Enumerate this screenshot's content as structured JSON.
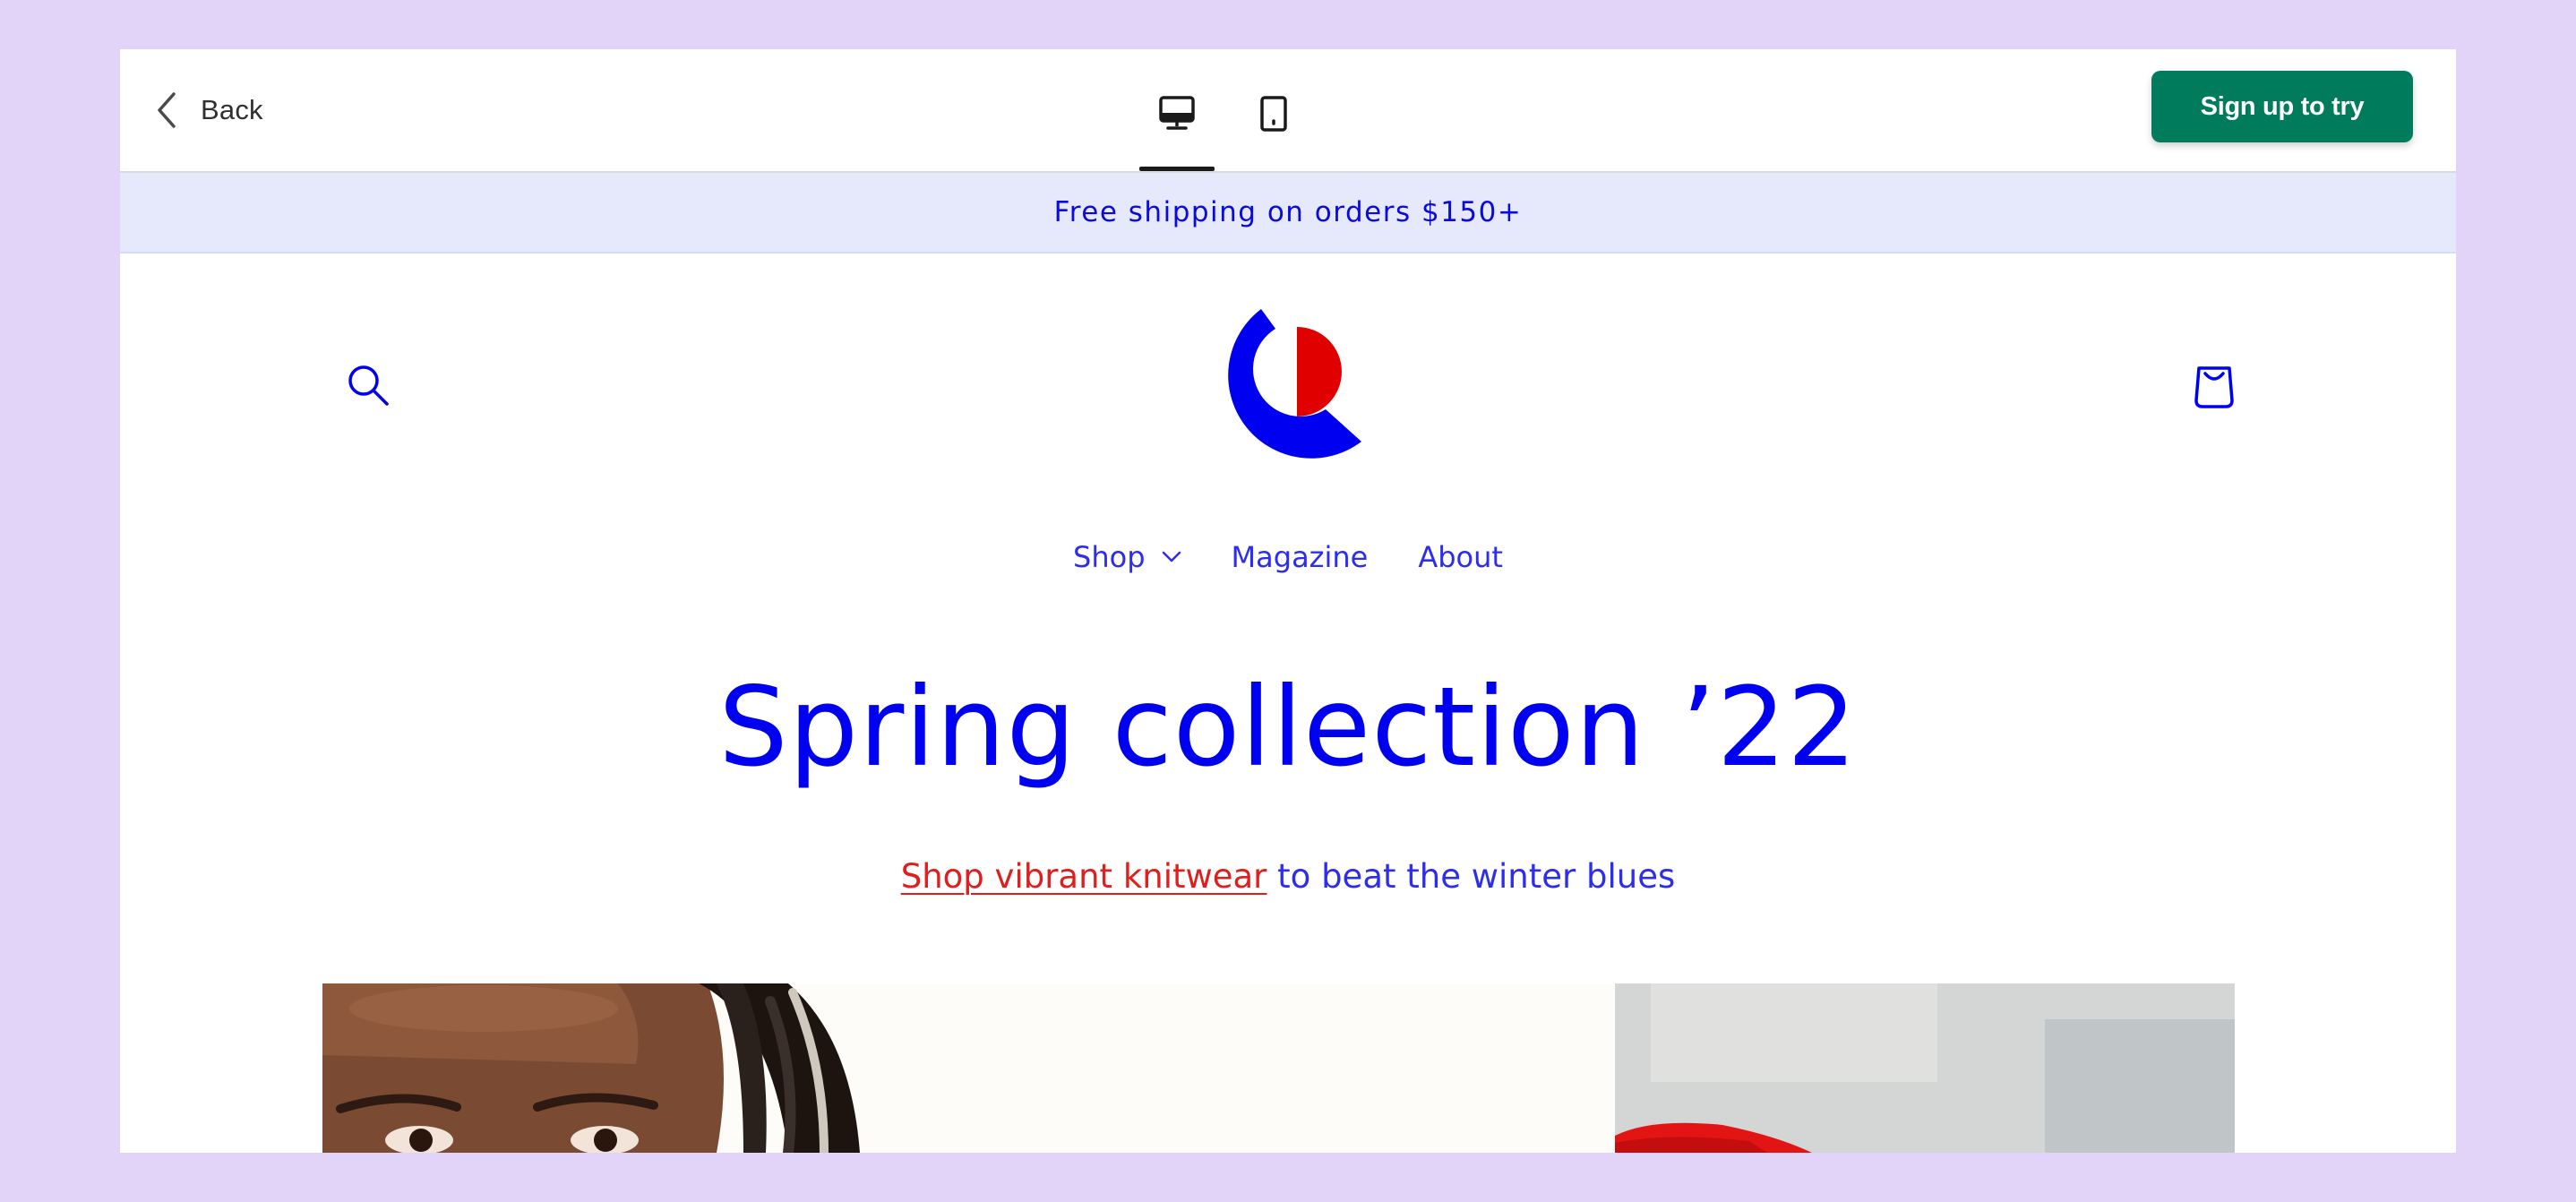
{
  "toolbar": {
    "back_label": "Back",
    "device_tabs": [
      "desktop-view",
      "mobile-view"
    ],
    "active_tab": "desktop-view",
    "signup_label": "Sign up to try",
    "signup_color": "#007b5c"
  },
  "announcement": {
    "text": "Free shipping on orders $150+"
  },
  "store": {
    "nav": {
      "shop": "Shop",
      "magazine": "Magazine",
      "about": "About"
    },
    "hero": {
      "title": "Spring collection ’22",
      "link_text": "Shop vibrant knitwear",
      "rest_text": " to beat the winter blues"
    },
    "colors": {
      "primary": "#0000f0",
      "accent": "#e01e1e",
      "announcement_bg": "#e6e9fc",
      "page_bg": "#e2d3f8"
    },
    "icons": [
      "search-icon",
      "logo",
      "cart-icon",
      "chevron-down-icon"
    ]
  }
}
